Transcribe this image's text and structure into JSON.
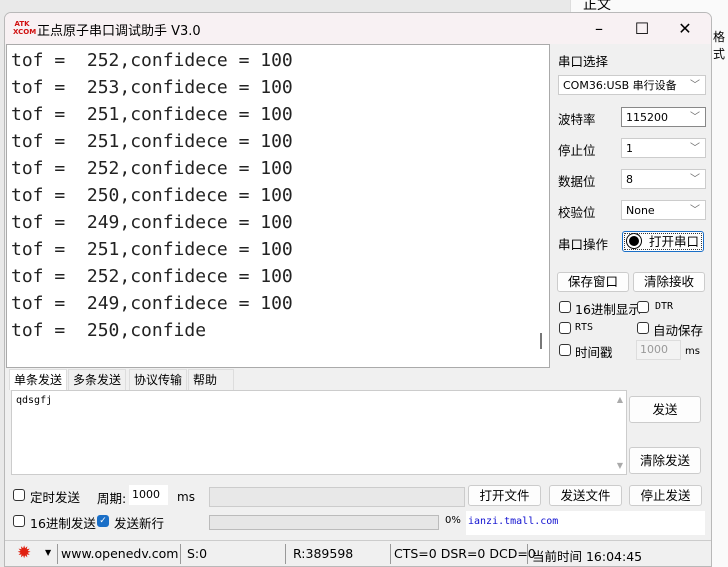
{
  "background": {
    "heading": "正文",
    "side_text": "格式"
  },
  "window": {
    "title": "正点原子串口调试助手 V3.0",
    "logo": "ATK XCOM",
    "minimize": "–",
    "maximize": "☐",
    "close": "✕"
  },
  "receive": {
    "lines": [
      "tof =  252,confidece = 100",
      "tof =  253,confidece = 100",
      "tof =  251,confidece = 100",
      "tof =  251,confidece = 100",
      "tof =  252,confidece = 100",
      "tof =  250,confidece = 100",
      "tof =  249,confidece = 100",
      "tof =  251,confidece = 100",
      "tof =  252,confidece = 100",
      "tof =  249,confidece = 100",
      "tof =  250,confide"
    ]
  },
  "settings": {
    "port_label": "串口选择",
    "port_value": "COM36:USB 串行设备",
    "baud_label": "波特率",
    "baud_value": "115200",
    "stop_label": "停止位",
    "stop_value": "1",
    "data_label": "数据位",
    "data_value": "8",
    "parity_label": "校验位",
    "parity_value": "None",
    "op_label": "串口操作",
    "open_port": "打开串口",
    "save_window": "保存窗口",
    "clear_receive": "清除接收",
    "hex_display": "16进制显示",
    "dtr": "DTR",
    "rts": "RTS",
    "auto_save": "自动保存",
    "timestamp": "时间戳",
    "timestamp_value": "1000",
    "ms": "ms"
  },
  "tabs": [
    "单条发送",
    "多条发送",
    "协议传输",
    "帮助"
  ],
  "send": {
    "text": "qdsgfj",
    "send": "发送",
    "clear_send": "清除发送",
    "timed_send": "定时发送",
    "period_label": "周期:",
    "period_value": "1000",
    "ms": "ms",
    "open_file": "打开文件",
    "send_file": "发送文件",
    "stop_send": "停止发送",
    "hex_send": "16进制发送",
    "send_newline": "发送新行",
    "progress_percent": "0%",
    "progress": 0,
    "link": "ianzi.tmall.com"
  },
  "status": {
    "url": "www.openedv.com",
    "sent": "S:0",
    "received": "R:389598",
    "signals": "CTS=0 DSR=0 DCD=0",
    "time": "当前时间 16:04:45"
  }
}
